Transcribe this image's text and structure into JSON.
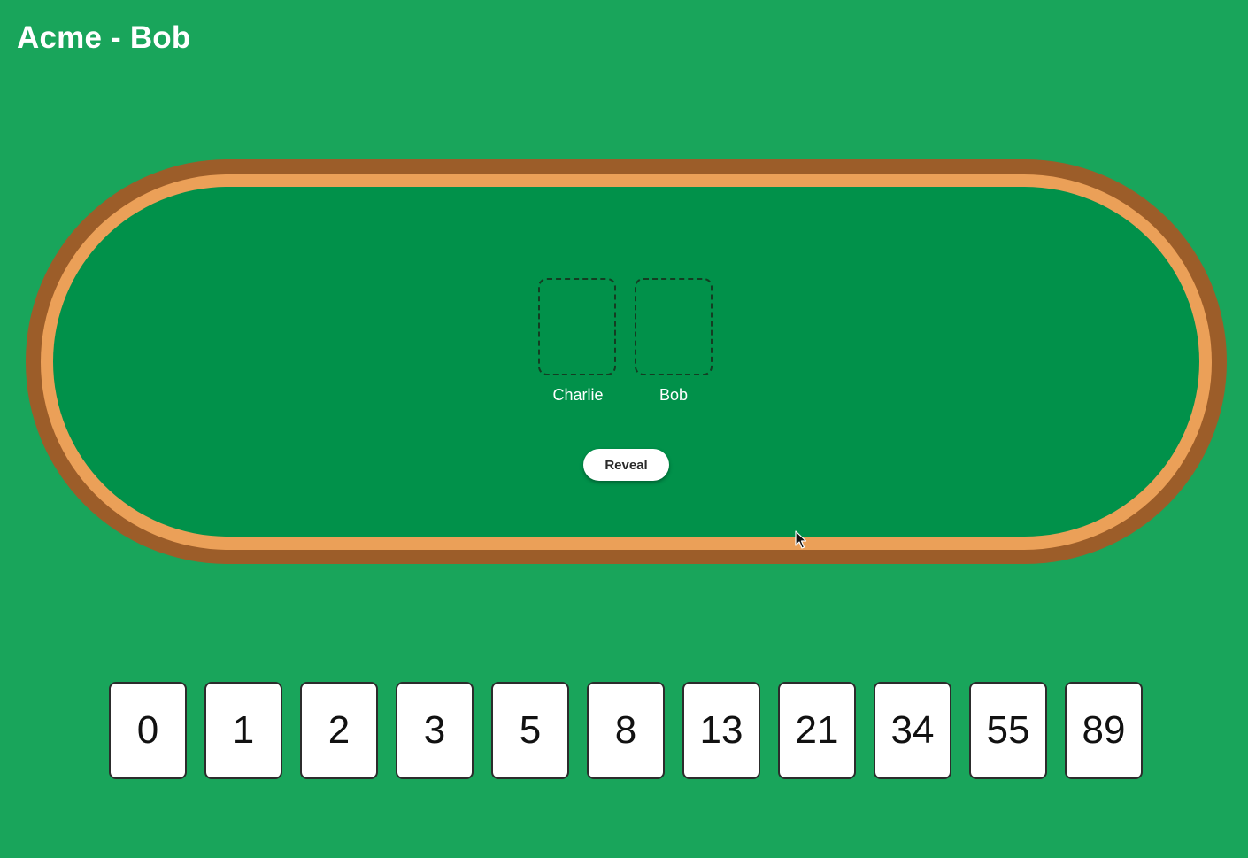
{
  "header": {
    "title": "Acme - Bob"
  },
  "table": {
    "players": [
      {
        "name": "Charlie",
        "card": null
      },
      {
        "name": "Bob",
        "card": null
      }
    ],
    "reveal_label": "Reveal"
  },
  "hand": {
    "cards": [
      "0",
      "1",
      "2",
      "3",
      "5",
      "8",
      "13",
      "21",
      "34",
      "55",
      "89"
    ]
  },
  "colors": {
    "background": "#19a55b",
    "felt": "#01914a",
    "rim_outer": "#9c5d29",
    "rim_inner": "#eba058"
  },
  "icons": {
    "cursor": "mouse-pointer-icon"
  }
}
